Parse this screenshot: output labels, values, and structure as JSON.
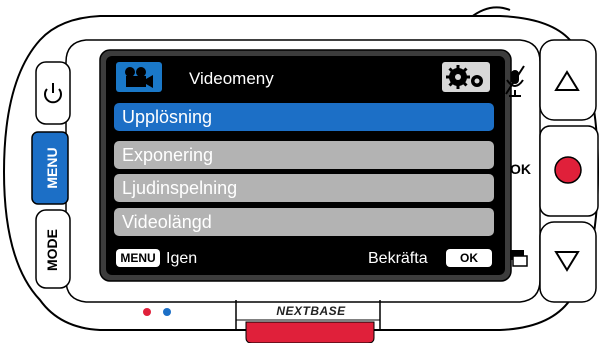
{
  "screen": {
    "title": "Videomeny",
    "items": [
      {
        "label": "Upplösning",
        "selected": true
      },
      {
        "label": "Exponering",
        "selected": false
      },
      {
        "label": "Ljudinspelning",
        "selected": false
      },
      {
        "label": "Videolängd",
        "selected": false
      }
    ],
    "footer": {
      "menu_badge": "MENU",
      "back_label": "Igen",
      "confirm_label": "Bekräfta",
      "ok_badge": "OK"
    },
    "icons": [
      "video-camera-icon",
      "settings-gears-icon",
      "mute-microphone-icon",
      "protect-file-icon"
    ]
  },
  "device": {
    "brand": "NEXTBASE",
    "left_buttons": [
      "power",
      "MENU",
      "MODE"
    ],
    "right_buttons": [
      "up",
      "record",
      "down"
    ],
    "ok_label": "OK",
    "colors": {
      "accent_blue": "#1c6fc6",
      "record_red": "#e0203a",
      "menu_item_grey": "#b3b3b3"
    }
  }
}
